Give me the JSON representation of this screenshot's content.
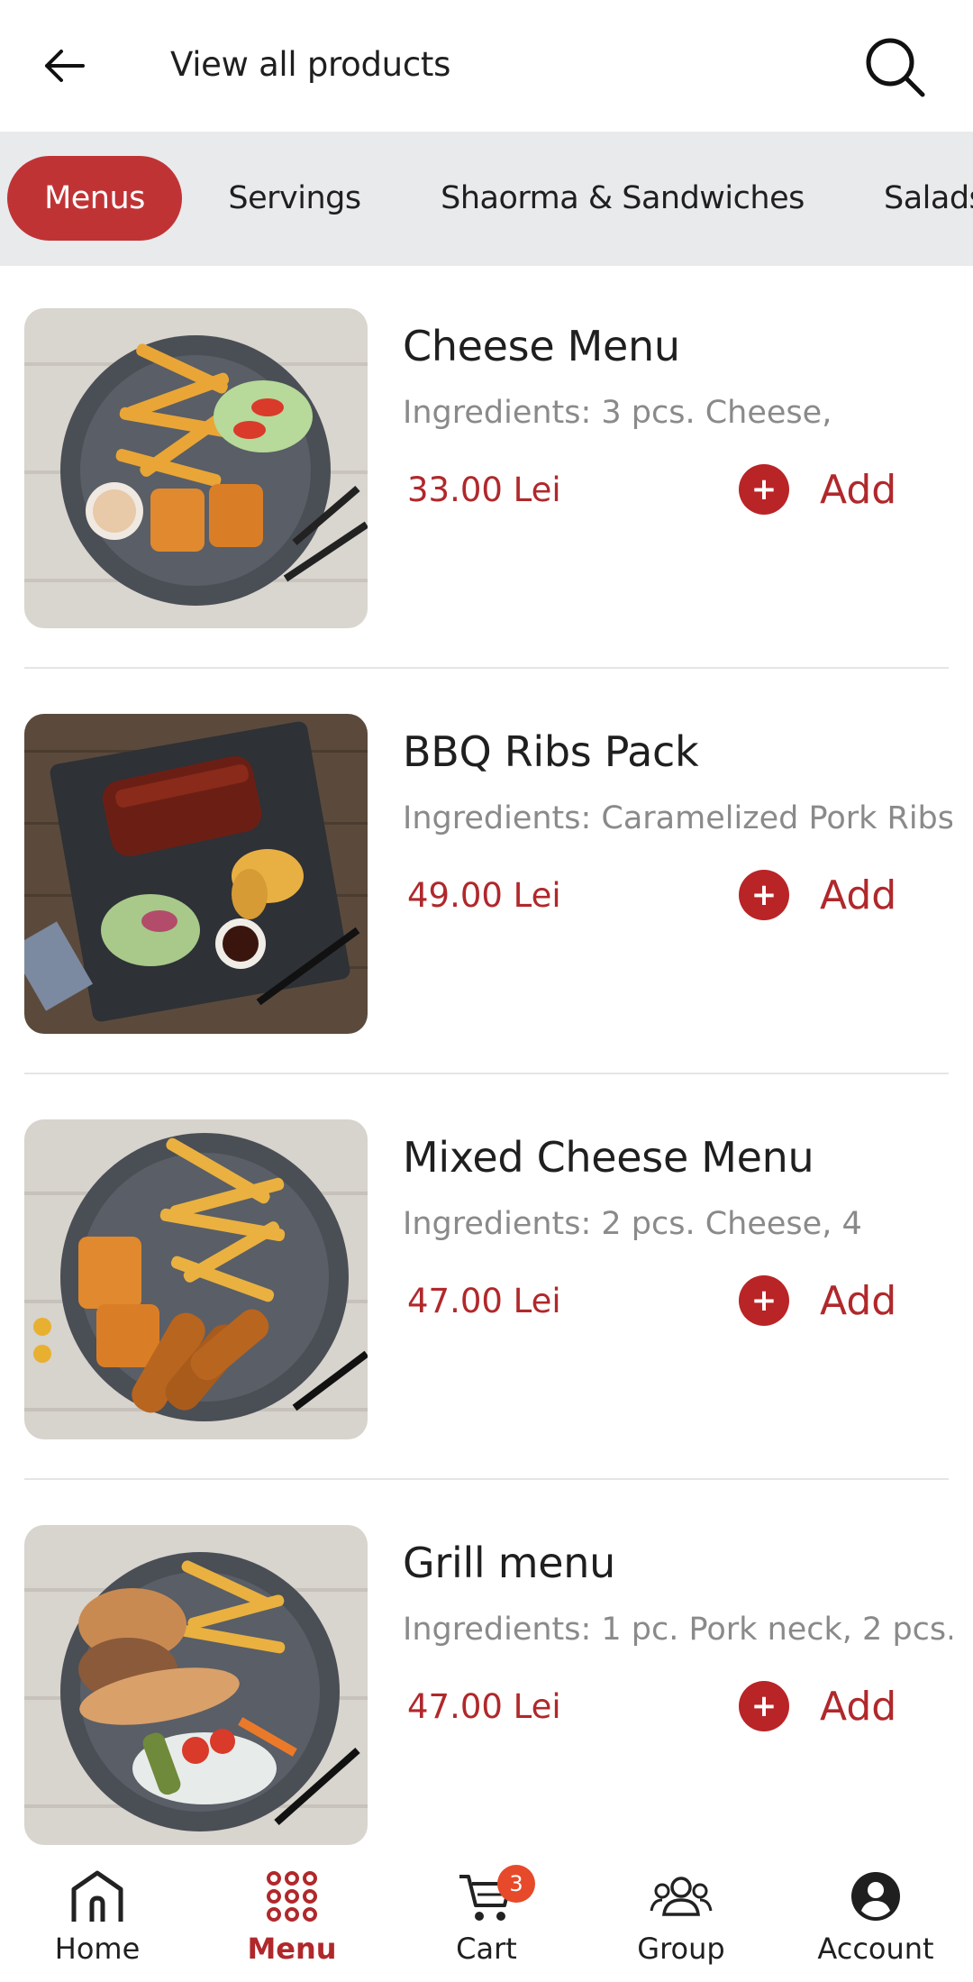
{
  "header": {
    "title": "View all products",
    "back_icon": "arrow-left-icon",
    "search_icon": "search-icon"
  },
  "tabs": [
    {
      "label": "Menus",
      "active": true
    },
    {
      "label": "Servings",
      "active": false
    },
    {
      "label": "Shaorma & Sandwiches",
      "active": false
    },
    {
      "label": "Salads",
      "active": false
    }
  ],
  "products": [
    {
      "name": "Cheese Menu",
      "ingredients": "Ingredients: 3 pcs. Cheese,",
      "price": "33.00 Lei",
      "add_label": "Add"
    },
    {
      "name": "BBQ Ribs Pack",
      "ingredients": "Ingredients: Caramelized Pork Ribs",
      "price": "49.00 Lei",
      "add_label": "Add"
    },
    {
      "name": " Mixed Cheese Menu",
      "ingredients": "Ingredients: 2 pcs. Cheese, 4",
      "price": "47.00 Lei",
      "add_label": "Add"
    },
    {
      "name": "Grill menu",
      "ingredients": "Ingredients: 1 pc. Pork neck, 2 pcs.",
      "price": "47.00 Lei",
      "add_label": "Add"
    }
  ],
  "bottom_nav": {
    "items": [
      {
        "label": "Home",
        "icon": "home-icon",
        "active": false
      },
      {
        "label": "Menu",
        "icon": "grid-dots-icon",
        "active": true
      },
      {
        "label": "Cart",
        "icon": "cart-icon",
        "active": false,
        "badge": "3"
      },
      {
        "label": "Group",
        "icon": "group-icon",
        "active": false
      },
      {
        "label": "Account",
        "icon": "account-icon",
        "active": false
      }
    ]
  },
  "colors": {
    "accent": "#c03335",
    "price": "#b0282b",
    "tab_bar_bg": "#e9eaec",
    "badge": "#e64a2a"
  }
}
